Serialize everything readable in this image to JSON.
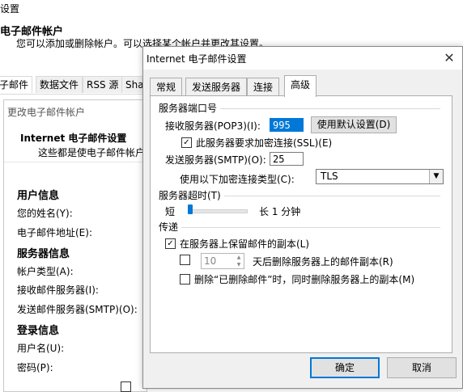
{
  "background_window": {
    "title": "设置",
    "header": "电子邮件帐户",
    "description": "您可以添加或删除帐户。可以选择某个帐户并更改其设置。",
    "tabs": [
      "子邮件",
      "数据文件",
      "RSS 源",
      "Sha"
    ]
  },
  "middle_window": {
    "title": "更改电子邮件帐户",
    "header": "Internet 电子邮件设置",
    "subheader": "这些都是使电子邮件帐户",
    "sections": {
      "user_info": "用户信息",
      "your_name": "您的姓名(Y):",
      "email": "电子邮件地址(E):",
      "server_info": "服务器信息",
      "account_type": "帐户类型(A):",
      "incoming": "接收邮件服务器(I):",
      "outgoing": "发送邮件服务器(SMTP)(O):",
      "logon_info": "登录信息",
      "username": "用户名(U):",
      "password": "密码(P):"
    }
  },
  "dialog": {
    "title": "Internet 电子邮件设置",
    "close_glyph": "✕",
    "tabs": [
      "常规",
      "发送服务器",
      "连接",
      "高级"
    ],
    "active_tab": "高级",
    "ports_group": "服务器端口号",
    "pop3_label": "接收服务器(POP3)(I):",
    "pop3_value": "995",
    "use_defaults_button": "使用默认设置(D)",
    "ssl_checkbox_label": "此服务器要求加密连接(SSL)(E)",
    "ssl_checked": true,
    "smtp_label": "发送服务器(SMTP)(O):",
    "smtp_value": "25",
    "encryption_label": "使用以下加密连接类型(C):",
    "encryption_value": "TLS",
    "timeout_group": "服务器超时(T)",
    "timeout_short": "短",
    "timeout_value": "长 1 分钟",
    "timeout_level": 0.0,
    "delivery_group": "传递",
    "leave_copy_label": "在服务器上保留邮件的副本(L)",
    "leave_copy_checked": true,
    "remove_after_label": "天后删除服务器上的邮件副本(R)",
    "remove_after_checked": false,
    "remove_after_days": "10",
    "remove_deleted_label": "删除“已删除邮件”时，同时删除服务器上的副本(M)",
    "remove_deleted_checked": false,
    "ok_button": "确定",
    "cancel_button": "取消"
  }
}
